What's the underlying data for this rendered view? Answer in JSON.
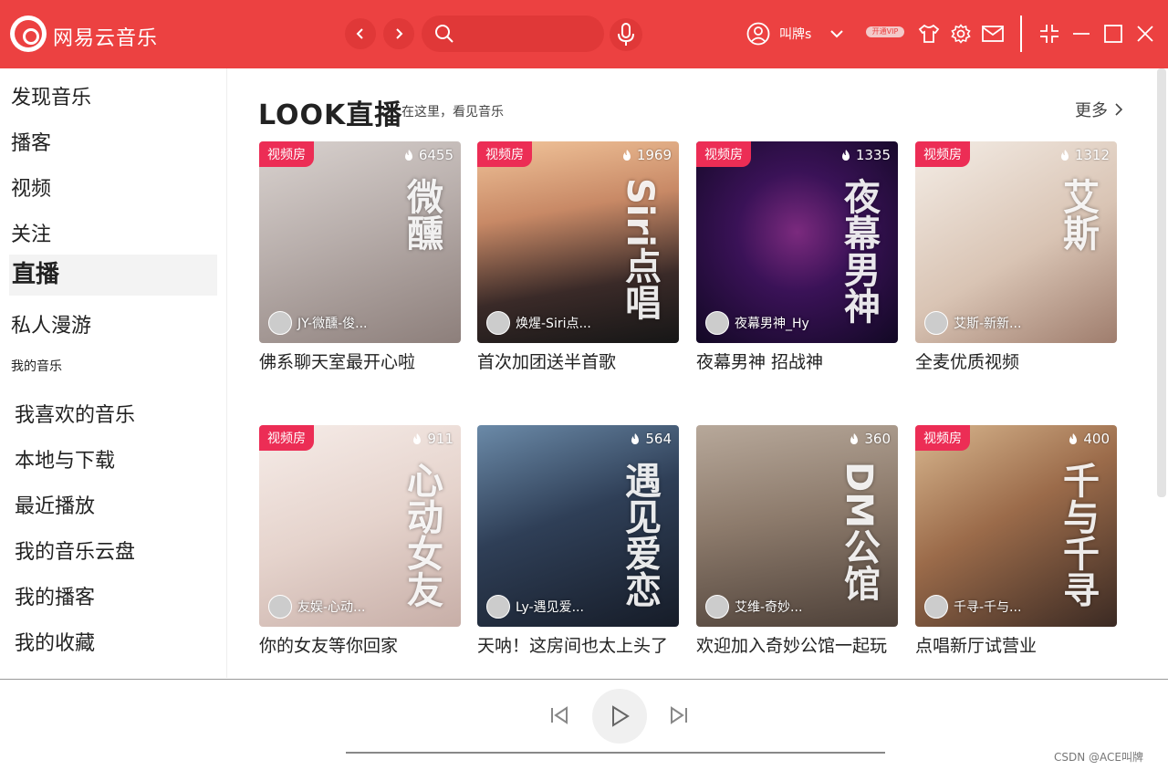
{
  "app": {
    "title": "网易云音乐"
  },
  "header": {
    "search_placeholder": "",
    "user_name": "叫牌s",
    "vip_label": "开通VIP",
    "colors": {
      "brand": "#ec4141",
      "tag": "#ec2d55"
    }
  },
  "sidebar": {
    "items": [
      {
        "label": "发现音乐"
      },
      {
        "label": "播客"
      },
      {
        "label": "视频"
      },
      {
        "label": "关注"
      },
      {
        "label": "直播",
        "active": true
      },
      {
        "label": "私人漫游"
      }
    ],
    "my_music_heading": "我的音乐",
    "my_music": [
      {
        "label": "我喜欢的音乐"
      },
      {
        "label": "本地与下载"
      },
      {
        "label": "最近播放"
      },
      {
        "label": "我的音乐云盘"
      },
      {
        "label": "我的播客"
      },
      {
        "label": "我的收藏"
      }
    ]
  },
  "main": {
    "section_title": "LOOK直播",
    "section_subtitle": "在这里，看见音乐",
    "more_label": "更多",
    "cards": [
      {
        "tag": "视频房",
        "heat": "6455",
        "host": "JY-微醺-俊...",
        "title": "佛系聊天室最开心啦",
        "art": "微醺",
        "bg": "linear-gradient(160deg,#d9d2cf 0%,#b8aeab 45%,#8d7f7b 100%)"
      },
      {
        "tag": "视频房",
        "heat": "1969",
        "host": "焕煋-Siri点...",
        "title": "首次加团送半首歌",
        "art": "Siri点唱",
        "bg": "linear-gradient(170deg,#f1c49a 0%,#c88966 35%,#3a2a28 70%,#161616 100%)"
      },
      {
        "tag": "视频房",
        "heat": "1335",
        "host": "夜幕男神_Hy",
        "title": "夜幕男神  招战神",
        "art": "夜幕男神",
        "bg": "radial-gradient(circle at 50% 45%,#7b2a7e 0%,#3a1257 40%,#120824 100%)"
      },
      {
        "tag": "视频房",
        "heat": "1312",
        "host": "艾斯-新新...",
        "title": "全麦优质视频",
        "art": "艾斯",
        "bg": "linear-gradient(150deg,#f4ede6 0%,#d9c4b4 55%,#9f7d6d 100%)"
      },
      {
        "tag": "视频房",
        "heat": "911",
        "host": "友娱-心动...",
        "title": "你的女友等你回家",
        "art": "心动女友",
        "bg": "linear-gradient(160deg,#f6ece8 0%,#e5d3cc 50%,#c7aea7 100%)"
      },
      {
        "tag": "",
        "heat": "564",
        "host": "Ly-遇见爱...",
        "title": "天呐！这房间也太上头了",
        "art": "遇见爱恋",
        "bg": "linear-gradient(160deg,#6b8aa8 0%,#2f3f57 45%,#161c28 100%)"
      },
      {
        "tag": "",
        "heat": "360",
        "host": "艾维-奇妙...",
        "title": "欢迎加入奇妙公馆一起玩",
        "art": "DM公馆",
        "bg": "linear-gradient(170deg,#b7a89a 0%,#8d7b6c 45%,#4d4038 100%)"
      },
      {
        "tag": "视频房",
        "heat": "400",
        "host": "千寻-千与...",
        "title": "点唱新厅试营业",
        "art": "千与千寻",
        "bg": "linear-gradient(150deg,#d9b78f 0%,#9b6b4a 45%,#3b2a23 100%)"
      }
    ]
  },
  "player": {
    "watermark": "CSDN @ACE叫牌"
  }
}
